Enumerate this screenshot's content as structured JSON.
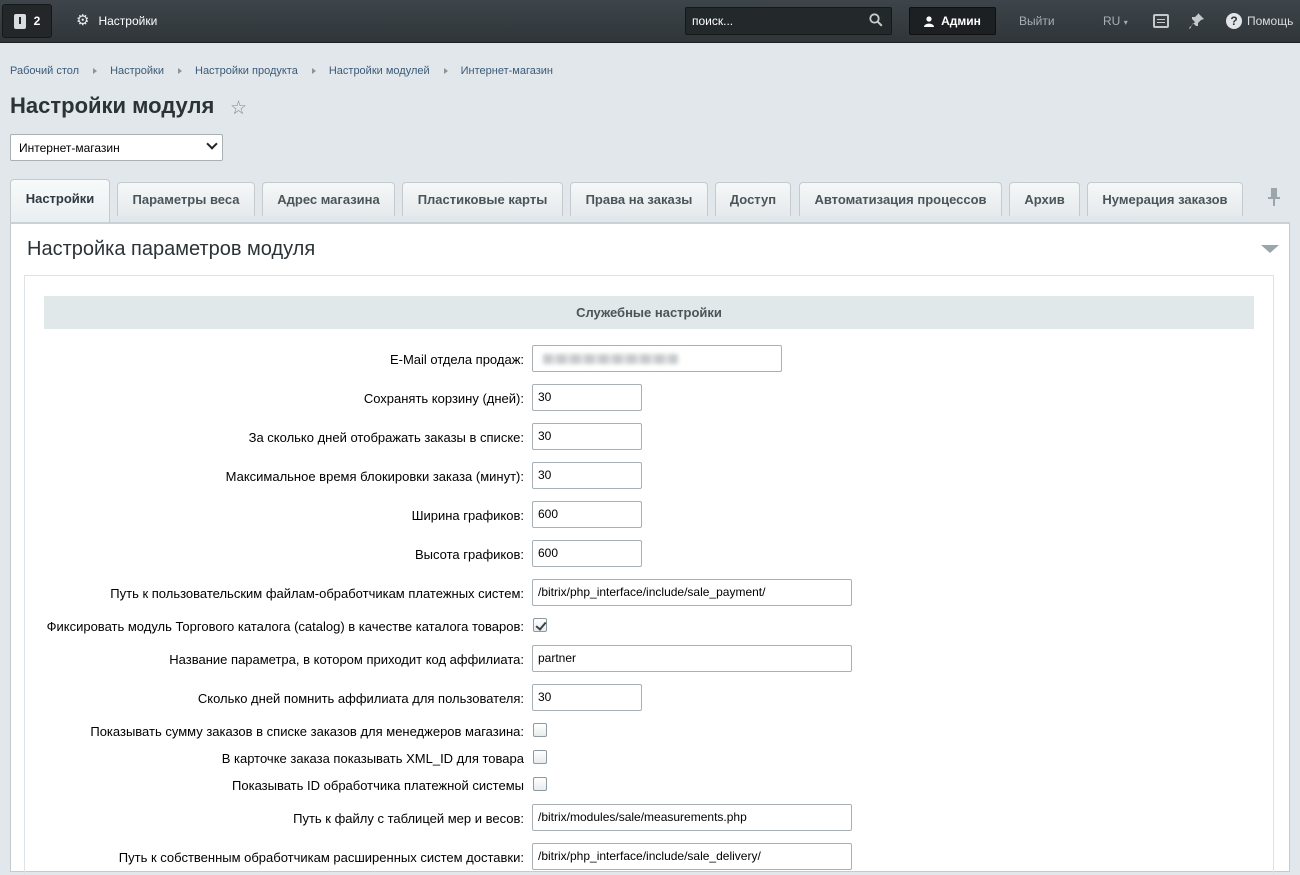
{
  "topbar": {
    "notifications_count": "2",
    "settings_label": "Настройки",
    "search_placeholder": "поиск...",
    "admin_label": "Админ",
    "logout_label": "Выйти",
    "lang_label": "RU",
    "help_label": "Помощь"
  },
  "breadcrumb": [
    "Рабочий стол",
    "Настройки",
    "Настройки продукта",
    "Настройки модулей",
    "Интернет-магазин"
  ],
  "page_title": "Настройки модуля",
  "module_select": "Интернет-магазин",
  "tabs": [
    {
      "label": "Настройки"
    },
    {
      "label": "Параметры веса"
    },
    {
      "label": "Адрес магазина"
    },
    {
      "label": "Пластиковые карты"
    },
    {
      "label": "Права на заказы"
    },
    {
      "label": "Доступ"
    },
    {
      "label": "Автоматизация процессов"
    },
    {
      "label": "Архив"
    },
    {
      "label": "Нумерация заказов"
    }
  ],
  "panel_title": "Настройка параметров модуля",
  "section_title": "Служебные настройки",
  "fields": [
    {
      "label": "E-Mail отдела продаж:",
      "value": ""
    },
    {
      "label": "Сохранять корзину (дней):",
      "value": "30"
    },
    {
      "label": "За сколько дней отображать заказы в списке:",
      "value": "30"
    },
    {
      "label": "Максимальное время блокировки заказа (минут):",
      "value": "30"
    },
    {
      "label": "Ширина графиков:",
      "value": "600"
    },
    {
      "label": "Высота графиков:",
      "value": "600"
    },
    {
      "label": "Путь к пользовательским файлам-обработчикам платежных систем:",
      "value": "/bitrix/php_interface/include/sale_payment/"
    },
    {
      "label": "Фиксировать модуль Торгового каталога (catalog) в качестве каталога товаров:",
      "checked": true
    },
    {
      "label": "Название параметра, в котором приходит код аффилиата:",
      "value": "partner"
    },
    {
      "label": "Сколько дней помнить аффилиата для пользователя:",
      "value": "30"
    },
    {
      "label": "Показывать сумму заказов в списке заказов для менеджеров магазина:",
      "checked": false
    },
    {
      "label": "В карточке заказа показывать XML_ID для товара",
      "checked": false
    },
    {
      "label": "Показывать ID обработчика платежной системы",
      "checked": false
    },
    {
      "label": "Путь к файлу с таблицей мер и весов:",
      "value": "/bitrix/modules/sale/measurements.php"
    },
    {
      "label": "Путь к собственным обработчикам расширенных систем доставки:",
      "value": "/bitrix/php_interface/include/sale_delivery/"
    }
  ]
}
